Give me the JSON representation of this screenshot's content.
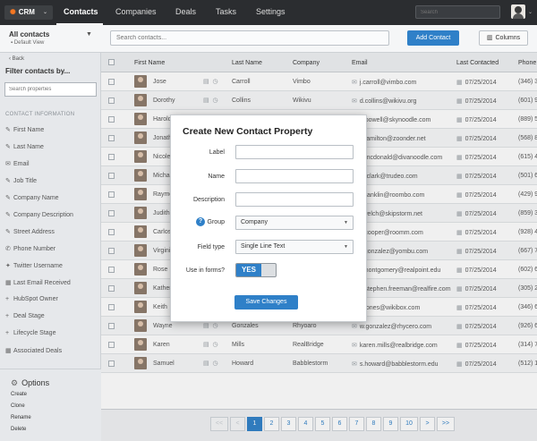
{
  "topbar": {
    "logo": "CRM",
    "nav": [
      "Contacts",
      "Companies",
      "Deals",
      "Tasks",
      "Settings"
    ],
    "search_placeholder": "Search"
  },
  "sidebar": {
    "view_title": "All contacts",
    "view_sub": "Default View",
    "back": "Back",
    "filter_title": "Filter contacts by...",
    "search_placeholder": "Search properties",
    "section": "CONTACT INFORMATION",
    "items": [
      {
        "icon": "edit-icon",
        "label": "First Name"
      },
      {
        "icon": "edit-icon",
        "label": "Last Name"
      },
      {
        "icon": "email-icon",
        "label": "Email"
      },
      {
        "icon": "edit-icon",
        "label": "Job Title"
      },
      {
        "icon": "edit-icon",
        "label": "Company Name"
      },
      {
        "icon": "edit-icon",
        "label": "Company Description"
      },
      {
        "icon": "edit-icon",
        "label": "Street Address"
      },
      {
        "icon": "phone-icon",
        "label": "Phone Number"
      },
      {
        "icon": "twitter-icon",
        "label": "Twitter Username"
      },
      {
        "icon": "calendar-icon",
        "label": "Last Email Received"
      },
      {
        "icon": "plus-icon",
        "label": "HubSpot Owner"
      },
      {
        "icon": "plus-icon",
        "label": "Deal Stage"
      },
      {
        "icon": "plus-icon",
        "label": "Lifecycle Stage"
      },
      {
        "icon": "calendar-icon",
        "label": "Associated Deals"
      }
    ],
    "options_title": "Options",
    "options": [
      "Create",
      "Clone",
      "Rename",
      "Delete"
    ]
  },
  "toolbar": {
    "search_placeholder": "Search contacts...",
    "add_label": "Add Contact",
    "columns_label": "Columns"
  },
  "table": {
    "headers": [
      "First Name",
      "Last Name",
      "Company",
      "Email",
      "Last Contacted",
      "Phone"
    ],
    "rows": [
      {
        "first": "Jose",
        "last": "Carroll",
        "company": "Vimbo",
        "email": "j.carroll@vimbo.com",
        "date": "07/25/2014",
        "phone": "(346) 3"
      },
      {
        "first": "Dorothy",
        "last": "Collins",
        "company": "Wikivu",
        "email": "d.collins@wikivu.org",
        "date": "07/25/2014",
        "phone": "(601) 9"
      },
      {
        "first": "Harold",
        "last": "",
        "company": "",
        "email": "p.powell@skynoodle.com",
        "date": "07/25/2014",
        "phone": "(889) 5"
      },
      {
        "first": "Jonathan",
        "last": "",
        "company": "",
        "email": "j.hamilton@zoonder.net",
        "date": "07/25/2014",
        "phone": "(568) 8"
      },
      {
        "first": "Nicole",
        "last": "",
        "company": "",
        "email": "n.mcdonald@divanoodle.com",
        "date": "07/25/2014",
        "phone": "(615) 4"
      },
      {
        "first": "Michael",
        "last": "",
        "company": "",
        "email": "m.clark@trudeo.com",
        "date": "07/25/2014",
        "phone": "(501) 6"
      },
      {
        "first": "Raymond",
        "last": "",
        "company": "",
        "email": "r.franklin@roombo.com",
        "date": "07/25/2014",
        "phone": "(429) 9"
      },
      {
        "first": "Judith",
        "last": "",
        "company": "",
        "email": "j.welch@skipstorm.net",
        "date": "07/25/2014",
        "phone": "(859) 3"
      },
      {
        "first": "Carlos",
        "last": "",
        "company": "",
        "email": "c.cooper@roomm.com",
        "date": "07/25/2014",
        "phone": "(928) 4"
      },
      {
        "first": "Virginia",
        "last": "",
        "company": "",
        "email": "v.gonzalez@yombu.com",
        "date": "07/25/2014",
        "phone": "(667) 7"
      },
      {
        "first": "Rose",
        "last": "",
        "company": "",
        "email": "r.montgomery@realpoint.edu",
        "date": "07/25/2014",
        "phone": "(602) 6"
      },
      {
        "first": "Katherine",
        "last": "",
        "company": "",
        "email": "k.stephen.freeman@realfire.com",
        "date": "07/25/2014",
        "phone": "(305) 2"
      },
      {
        "first": "Keith",
        "last": "Jones",
        "company": "Wikibox",
        "email": "k.jones@wikibox.com",
        "date": "07/25/2014",
        "phone": "(346) 6"
      },
      {
        "first": "Wayne",
        "last": "Gonzales",
        "company": "Rhyoaro",
        "email": "w.gonzalez@rhycero.com",
        "date": "07/25/2014",
        "phone": "(926) 6"
      },
      {
        "first": "Karen",
        "last": "Mills",
        "company": "RealBridge",
        "email": "karen.mills@realbridge.com",
        "date": "07/25/2014",
        "phone": "(314) 7"
      },
      {
        "first": "Samuel",
        "last": "Howard",
        "company": "Babblestorm",
        "email": "s.howard@babblestorm.edu",
        "date": "07/25/2014",
        "phone": "(512) 1"
      }
    ]
  },
  "pager": {
    "prev2": "<<",
    "prev": "<",
    "pages": [
      "1",
      "2",
      "3",
      "4",
      "5",
      "6",
      "7",
      "8",
      "9",
      "10"
    ],
    "active": "1",
    "next": ">",
    "next2": ">>"
  },
  "modal": {
    "title": "Create New Contact Property",
    "label_label": "Label",
    "name_label": "Name",
    "description_label": "Description",
    "group_label": "Group",
    "group_value": "Company",
    "fieldtype_label": "Field type",
    "fieldtype_value": "Single Line Text",
    "informs_label": "Use in forms?",
    "toggle_value": "YES",
    "save_label": "Save Changes"
  },
  "colors": {
    "accent": "#2f80c8",
    "topbar": "#2b2d30",
    "logo_mark": "#f57722"
  }
}
